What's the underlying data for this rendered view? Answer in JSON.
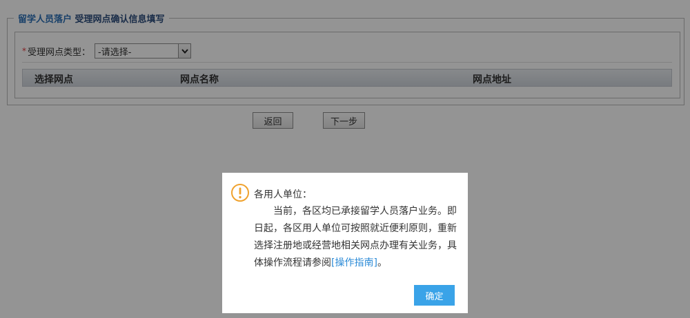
{
  "form": {
    "legend_part1": "留学人员落户",
    "legend_part2": "受理网点确认信息填写",
    "required_mark": "*",
    "type_label": "受理网点类型：",
    "type_select_value": "-请选择-",
    "columns": [
      "选择网点",
      "网点名称",
      "网点地址"
    ]
  },
  "actions": {
    "back_label": "返回",
    "next_label": "下一步"
  },
  "dialog": {
    "icon": "warning-icon",
    "greeting": "各用人单位：",
    "message_before_link": "当前，各区均已承接留学人员落户业务。即日起，各区用人单位可按照就近便利原则，重新选择注册地或经营地相关网点办理有关业务，具体操作流程请参阅",
    "link_text": "[操作指南]",
    "message_after_link": "。",
    "confirm_label": "确定"
  },
  "colors": {
    "legend_blue": "#2a6fb6",
    "legend_dark": "#2e4e7e",
    "link": "#2c8bd7",
    "confirm_button": "#3aa3e8",
    "warning_icon": "#f0a22e"
  }
}
